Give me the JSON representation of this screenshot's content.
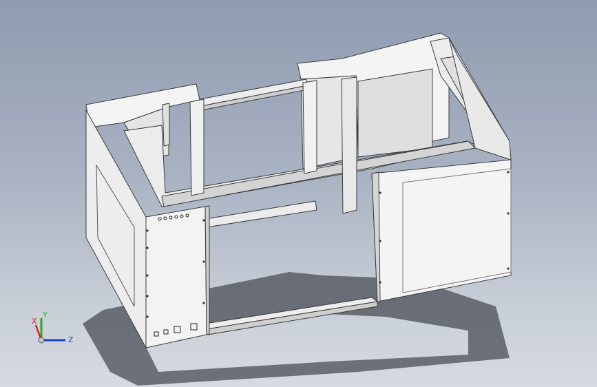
{
  "viewport": {
    "background_top": "#8f9bb0",
    "background_bottom": "#d6dae1"
  },
  "model": {
    "type": "sheet-metal enclosure frame",
    "colors": {
      "face_light": "#f4f4f4",
      "face_mid": "#e2e2e2",
      "face_dark": "#c9c9c9",
      "edge": "#3a3a3a",
      "shadow": "#4a4e55"
    }
  },
  "triad": {
    "x_label": "X",
    "y_label": "Y",
    "z_label": "Z",
    "x_color": "#d92020",
    "y_color": "#2aa52a",
    "z_color": "#1f3fd6"
  }
}
